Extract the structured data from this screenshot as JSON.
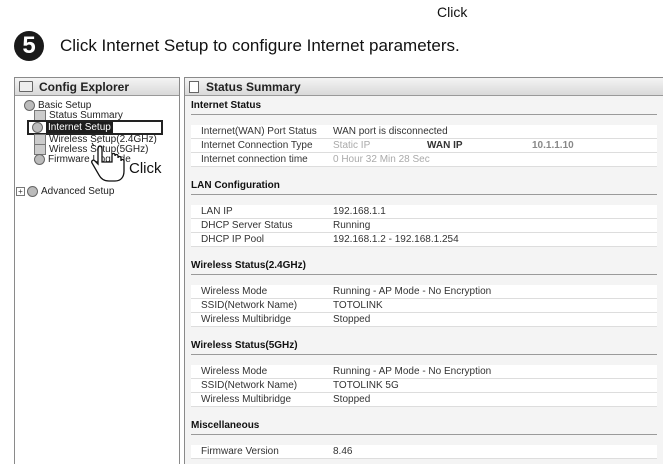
{
  "top_label": "Click",
  "instruction": {
    "step": "5",
    "text": "Click Internet Setup to configure Internet parameters."
  },
  "explorer": {
    "title": "Config Explorer",
    "basic_setup": "Basic Setup",
    "status_summary": "Status Summary",
    "internet_setup": "Internet Setup",
    "wireless_24": "Wireless Setup(2.4GHz)",
    "wireless_5": "Wireless Setup(5GHz)",
    "firmware": "Firmware Upgrade",
    "advanced_setup": "Advanced Setup",
    "hand_label": "Click"
  },
  "panel": {
    "title": "Status Summary",
    "internet_status": {
      "title": "Internet Status",
      "port_status_label": "Internet(WAN) Port Status",
      "port_status_value": "WAN port is disconnected",
      "conn_type_label": "Internet Connection Type",
      "conn_type_value": "Static IP",
      "wan_ip_label": "WAN IP",
      "wan_ip_value": "10.1.1.10",
      "conn_time_label": "Internet connection time",
      "conn_time_value": "0 Hour 32 Min 28 Sec"
    },
    "lan": {
      "title": "LAN Configuration",
      "ip_label": "LAN IP",
      "ip_value": "192.168.1.1",
      "dhcp_label": "DHCP Server Status",
      "dhcp_value": "Running",
      "pool_label": "DHCP IP Pool",
      "pool_value": "192.168.1.2 -  192.168.1.254"
    },
    "wireless24": {
      "title": "Wireless Status(2.4GHz)",
      "mode_label": "Wireless Mode",
      "mode_value": "Running - AP Mode - No Encryption",
      "ssid_label": "SSID(Network Name)",
      "ssid_value": "TOTOLINK",
      "multi_label": "Wireless Multibridge",
      "multi_value": "Stopped"
    },
    "wireless5": {
      "title": "Wireless Status(5GHz)",
      "mode_label": "Wireless Mode",
      "mode_value": "Running - AP Mode - No Encryption",
      "ssid_label": "SSID(Network Name)",
      "ssid_value": "TOTOLINK 5G",
      "multi_label": "Wireless Multibridge",
      "multi_value": "Stopped"
    },
    "misc": {
      "title": "Miscellaneous",
      "fw_label": "Firmware Version",
      "fw_value": "8.46"
    }
  }
}
